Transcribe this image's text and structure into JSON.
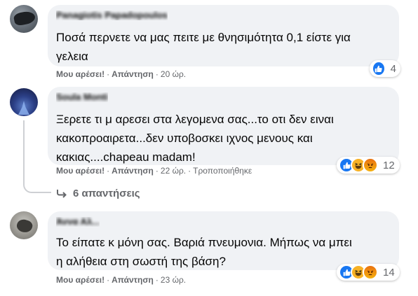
{
  "comments": [
    {
      "author": "Panagiotis Papadopoulos",
      "text": "Ποσά περνετε να μας πειτε με θνησιμότητα 0,1 είστε για\nγελεια",
      "actions": {
        "like": "Μου αρέσει!",
        "reply": "Απάντηση",
        "time": "20 ώρ."
      },
      "reactions": {
        "icons": [
          "like-icon"
        ],
        "count": "4"
      }
    },
    {
      "author": "Soula Monti",
      "text": "Ξερετε τι μ αρεσει στα λεγομενα σας...το οτι δεν ειναι\nκακοπροαιρετα...δεν υποβοσκει ιχνος μενους και\nκακιας....chapeau madam!",
      "actions": {
        "like": "Μου αρέσει!",
        "reply": "Απάντηση",
        "time": "22 ώρ.",
        "edited": "Τροποποιήθηκε"
      },
      "reactions": {
        "icons": [
          "like-icon",
          "haha-icon",
          "angry-icon"
        ],
        "count": "12"
      },
      "replies_label": "6 απαντήσεις"
    },
    {
      "author": "Άννα Αλ...",
      "text": "Το είπατε κ μόνη σας. Βαριά πνευμονια. Μήπως να μπει\nη αλήθεια στη σωστή της βάση?",
      "actions": {
        "like": "Μου αρέσει!",
        "reply": "Απάντηση",
        "time": "23 ώρ."
      },
      "reactions": {
        "icons": [
          "like-icon",
          "haha-icon",
          "angry-icon"
        ],
        "count": "14"
      }
    }
  ],
  "separator": "·",
  "colors": {
    "bubble": "#f0f2f5",
    "meta_text": "#65676b",
    "like": "#1877f2",
    "haha": "#f7b125",
    "angry": "#e9710f",
    "thread_line": "#ced0d4"
  }
}
